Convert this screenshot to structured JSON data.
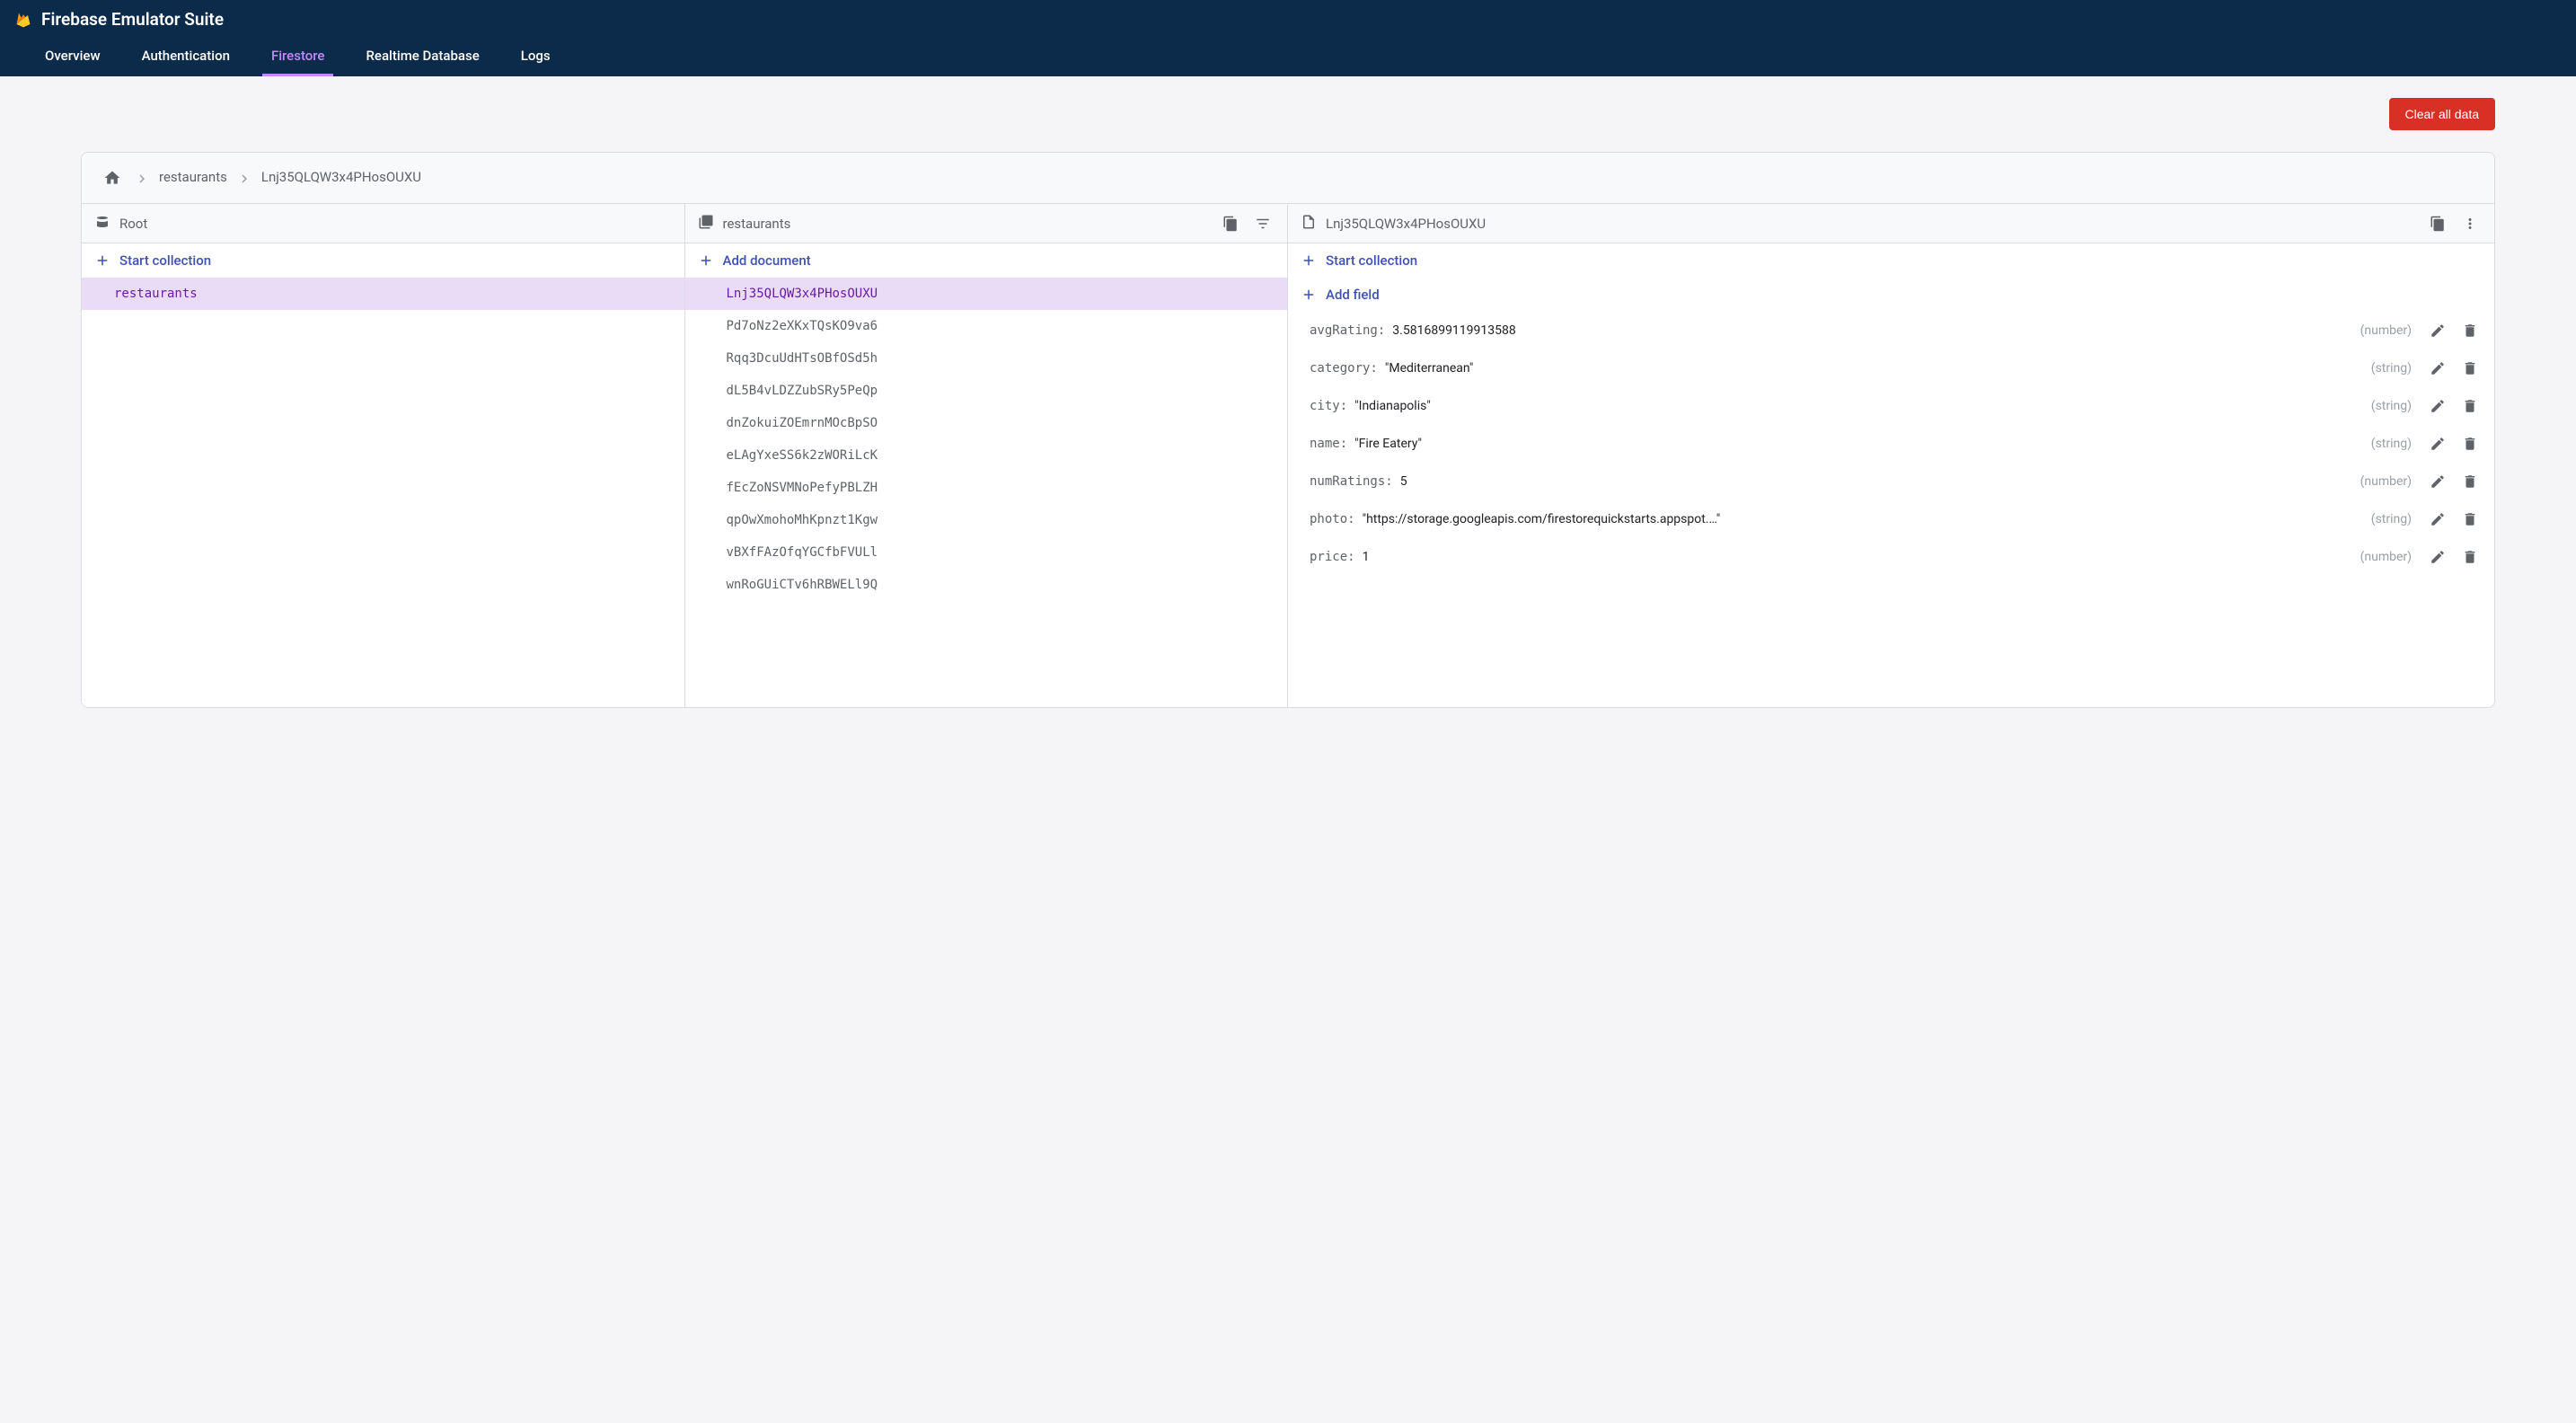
{
  "header": {
    "title": "Firebase Emulator Suite",
    "tabs": [
      {
        "label": "Overview",
        "active": false
      },
      {
        "label": "Authentication",
        "active": false
      },
      {
        "label": "Firestore",
        "active": true
      },
      {
        "label": "Realtime Database",
        "active": false
      },
      {
        "label": "Logs",
        "active": false
      }
    ]
  },
  "toolbar": {
    "clear_btn": "Clear all data"
  },
  "breadcrumb": {
    "parts": [
      "restaurants",
      "Lnj35QLQW3x4PHosOUXU"
    ]
  },
  "columns": {
    "root": {
      "title": "Root",
      "action": "Start collection",
      "items": [
        {
          "label": "restaurants",
          "selected": true
        }
      ]
    },
    "docs": {
      "title": "restaurants",
      "action": "Add document",
      "items": [
        {
          "label": "Lnj35QLQW3x4PHosOUXU",
          "selected": true
        },
        {
          "label": "Pd7oNz2eXKxTQsKO9va6"
        },
        {
          "label": "Rqq3DcuUdHTsOBfOSd5h"
        },
        {
          "label": "dL5B4vLDZZubSRy5PeQp"
        },
        {
          "label": "dnZokuiZOEmrnMOcBpSO"
        },
        {
          "label": "eLAgYxeSS6k2zWORiLcK"
        },
        {
          "label": "fEcZoNSVMNoPefyPBLZH"
        },
        {
          "label": "qpOwXmohoMhKpnzt1Kgw"
        },
        {
          "label": "vBXfFAzOfqYGCfbFVULl"
        },
        {
          "label": "wnRoGUiCTv6hRBWELl9Q"
        }
      ]
    },
    "fields": {
      "title": "Lnj35QLQW3x4PHosOUXU",
      "start_action": "Start collection",
      "add_action": "Add field",
      "rows": [
        {
          "key": "avgRating",
          "value": "3.5816899119913588",
          "type": "number",
          "quoted": false
        },
        {
          "key": "category",
          "value": "Mediterranean",
          "type": "string",
          "quoted": true
        },
        {
          "key": "city",
          "value": "Indianapolis",
          "type": "string",
          "quoted": true
        },
        {
          "key": "name",
          "value": "Fire Eatery",
          "type": "string",
          "quoted": true
        },
        {
          "key": "numRatings",
          "value": "5",
          "type": "number",
          "quoted": false
        },
        {
          "key": "photo",
          "value": "https://storage.googleapis.com/firestorequickstarts.appspot.…",
          "type": "string",
          "quoted": true
        },
        {
          "key": "price",
          "value": "1",
          "type": "number",
          "quoted": false
        }
      ]
    }
  }
}
